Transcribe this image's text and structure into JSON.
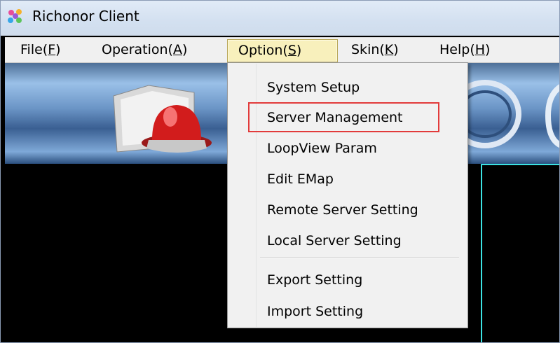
{
  "window": {
    "title": "Richonor Client"
  },
  "menubar": [
    {
      "label": "File(",
      "key": "F",
      "tail": ")"
    },
    {
      "label": "Operation(",
      "key": "A",
      "tail": ")"
    },
    {
      "label": "Option(",
      "key": "S",
      "tail": ")"
    },
    {
      "label": "Skin(",
      "key": "K",
      "tail": ")"
    },
    {
      "label": "Help(",
      "key": "H",
      "tail": ")"
    }
  ],
  "active_menu": "Option",
  "option_menu": {
    "items": [
      "System Setup",
      "Server Management",
      "LoopView Param",
      "Edit EMap",
      "Remote Server Setting",
      "Local Server Setting",
      "Export Setting",
      "Import Setting"
    ],
    "highlighted": "Server Management"
  },
  "colors": {
    "highlight_box": "#e23b3b",
    "active_menu_bg": "#f8f0bc",
    "video_frame": "#3ce3e3"
  }
}
